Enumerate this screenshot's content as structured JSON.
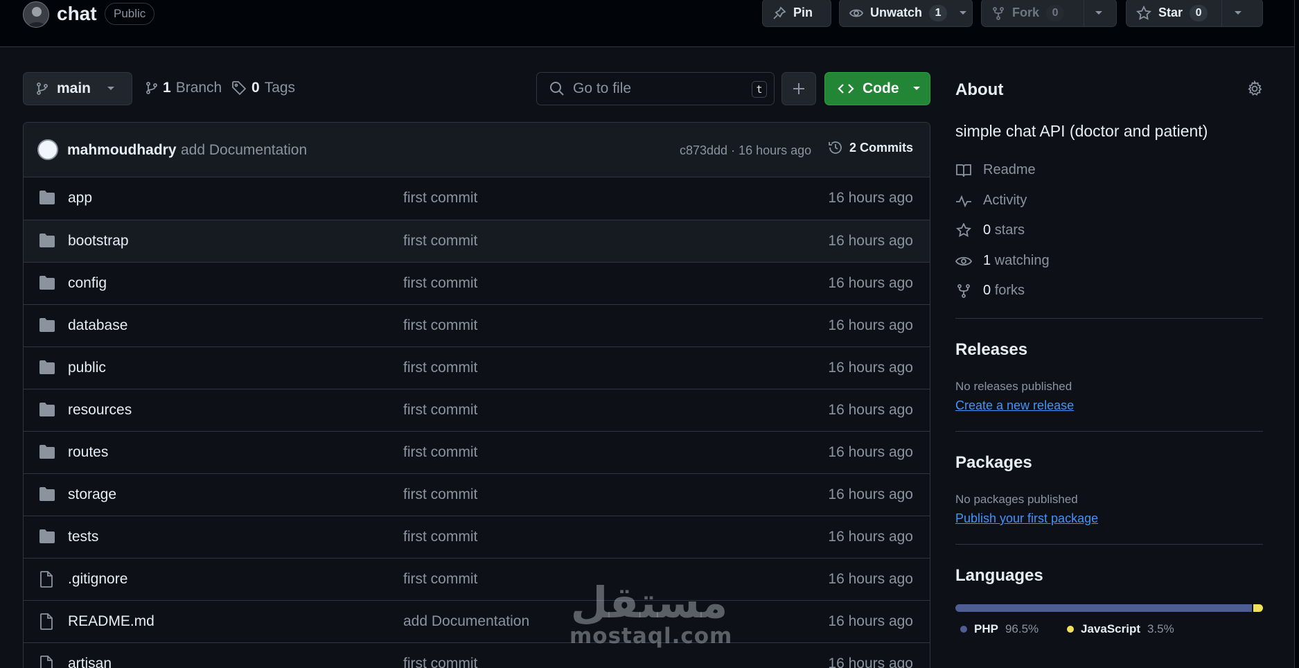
{
  "repo": {
    "name": "chat",
    "visibility": "Public"
  },
  "actions": {
    "pin": "Pin",
    "unwatch": "Unwatch",
    "watch_count": "1",
    "fork": "Fork",
    "fork_count": "0",
    "star": "Star",
    "star_count": "0"
  },
  "toolbar": {
    "branch": "main",
    "branches_count": "1",
    "branches_label": "Branch",
    "tags_count": "0",
    "tags_label": "Tags",
    "search_placeholder": "Go to file",
    "search_shortcut": "t",
    "code_label": "Code"
  },
  "latest_commit": {
    "author": "mahmoudhadry",
    "message": "add Documentation",
    "meta": "c873ddd · 16 hours ago",
    "commits_label": "2 Commits"
  },
  "files": [
    {
      "name": "app",
      "type": "dir",
      "message": "first commit",
      "date": "16 hours ago"
    },
    {
      "name": "bootstrap",
      "type": "dir",
      "message": "first commit",
      "date": "16 hours ago"
    },
    {
      "name": "config",
      "type": "dir",
      "message": "first commit",
      "date": "16 hours ago"
    },
    {
      "name": "database",
      "type": "dir",
      "message": "first commit",
      "date": "16 hours ago"
    },
    {
      "name": "public",
      "type": "dir",
      "message": "first commit",
      "date": "16 hours ago"
    },
    {
      "name": "resources",
      "type": "dir",
      "message": "first commit",
      "date": "16 hours ago"
    },
    {
      "name": "routes",
      "type": "dir",
      "message": "first commit",
      "date": "16 hours ago"
    },
    {
      "name": "storage",
      "type": "dir",
      "message": "first commit",
      "date": "16 hours ago"
    },
    {
      "name": "tests",
      "type": "dir",
      "message": "first commit",
      "date": "16 hours ago"
    },
    {
      "name": ".gitignore",
      "type": "file",
      "message": "first commit",
      "date": "16 hours ago"
    },
    {
      "name": "README.md",
      "type": "file",
      "message": "add Documentation",
      "date": "16 hours ago"
    },
    {
      "name": "artisan",
      "type": "file",
      "message": "first commit",
      "date": "16 hours ago"
    }
  ],
  "about": {
    "title": "About",
    "description": "simple chat API (doctor and patient)",
    "readme": "Readme",
    "activity": "Activity",
    "stars_count": "0",
    "stars_label": "stars",
    "watching_count": "1",
    "watching_label": "watching",
    "forks_count": "0",
    "forks_label": "forks"
  },
  "releases": {
    "title": "Releases",
    "empty_text": "No releases published",
    "link": "Create a new release"
  },
  "packages": {
    "title": "Packages",
    "empty_text": "No packages published",
    "link": "Publish your first package"
  },
  "languages": {
    "title": "Languages",
    "items": [
      {
        "name": "PHP",
        "percent": "96.5%",
        "value": 96.5,
        "color": "#4F5D95"
      },
      {
        "name": "JavaScript",
        "percent": "3.5%",
        "value": 3.5,
        "color": "#f1e05a"
      }
    ]
  },
  "watermark": {
    "arabic": "مستقل",
    "latin": "mostaql.com"
  }
}
